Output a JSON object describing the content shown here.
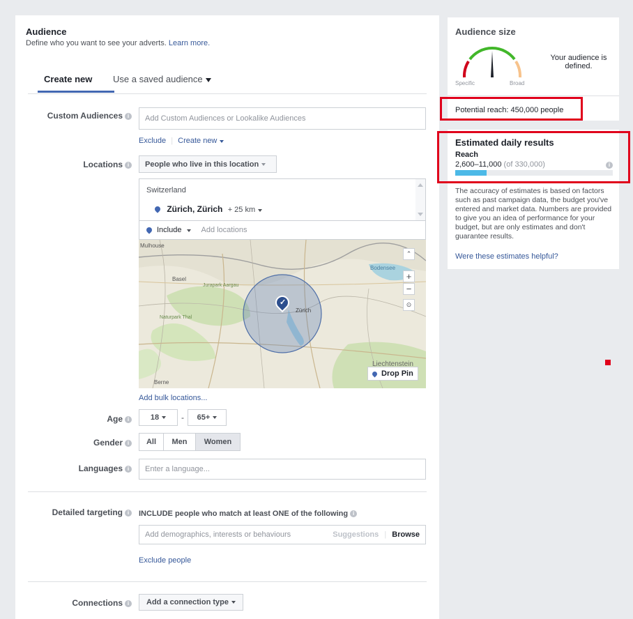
{
  "audience": {
    "title": "Audience",
    "subtitle": "Define who you want to see your adverts.",
    "learn_more": "Learn more.",
    "tabs": {
      "create_new": "Create new",
      "saved": "Use a saved audience"
    }
  },
  "custom_audiences": {
    "label": "Custom Audiences",
    "placeholder": "Add Custom Audiences or Lookalike Audiences",
    "exclude": "Exclude",
    "create_new": "Create new"
  },
  "locations": {
    "label": "Locations",
    "dropdown": "People who live in this location",
    "country": "Switzerland",
    "city": "Zürich, Zürich",
    "radius": "+ 25 km",
    "include": "Include",
    "add_placeholder": "Add locations",
    "bulk": "Add bulk locations...",
    "map": {
      "drop_pin": "Drop Pin",
      "zoom_in": "+",
      "zoom_out": "−",
      "places": [
        "Mulhouse",
        "Basel",
        "Jurapark Aargau",
        "Naturpark Thal",
        "Zürich",
        "Bodensee",
        "Liechtenstein",
        "Berne"
      ]
    }
  },
  "age": {
    "label": "Age",
    "min": "18",
    "max": "65+",
    "sep": "-"
  },
  "gender": {
    "label": "Gender",
    "options": [
      "All",
      "Men",
      "Women"
    ],
    "selected": "Women"
  },
  "languages": {
    "label": "Languages",
    "placeholder": "Enter a language..."
  },
  "detailed": {
    "label": "Detailed targeting",
    "include_text": "INCLUDE people who match at least ONE of the following",
    "placeholder": "Add demographics, interests or behaviours",
    "suggestions": "Suggestions",
    "browse": "Browse",
    "exclude": "Exclude people"
  },
  "connections": {
    "label": "Connections",
    "dropdown": "Add a connection type"
  },
  "audience_size": {
    "title": "Audience size",
    "status": "Your audience is defined.",
    "specific": "Specific",
    "broad": "Broad",
    "gauge_level": 0.5,
    "potential_reach": "Potential reach: 450,000 people"
  },
  "estimated": {
    "title": "Estimated daily results",
    "reach_label": "Reach",
    "reach_range": "2,600–11,000",
    "reach_total": "(of 330,000)",
    "reach_fraction": 0.2,
    "description": "The accuracy of estimates is based on factors such as past campaign data, the budget you've entered and market data. Numbers are provided to give you an idea of performance for your budget, but are only estimates and don't guarantee results.",
    "helpful": "Were these estimates helpful?"
  },
  "colors": {
    "accent": "#4267b2",
    "link": "#365899",
    "highlight": "#e0001b",
    "reach_bar": "#4cb9e7"
  }
}
